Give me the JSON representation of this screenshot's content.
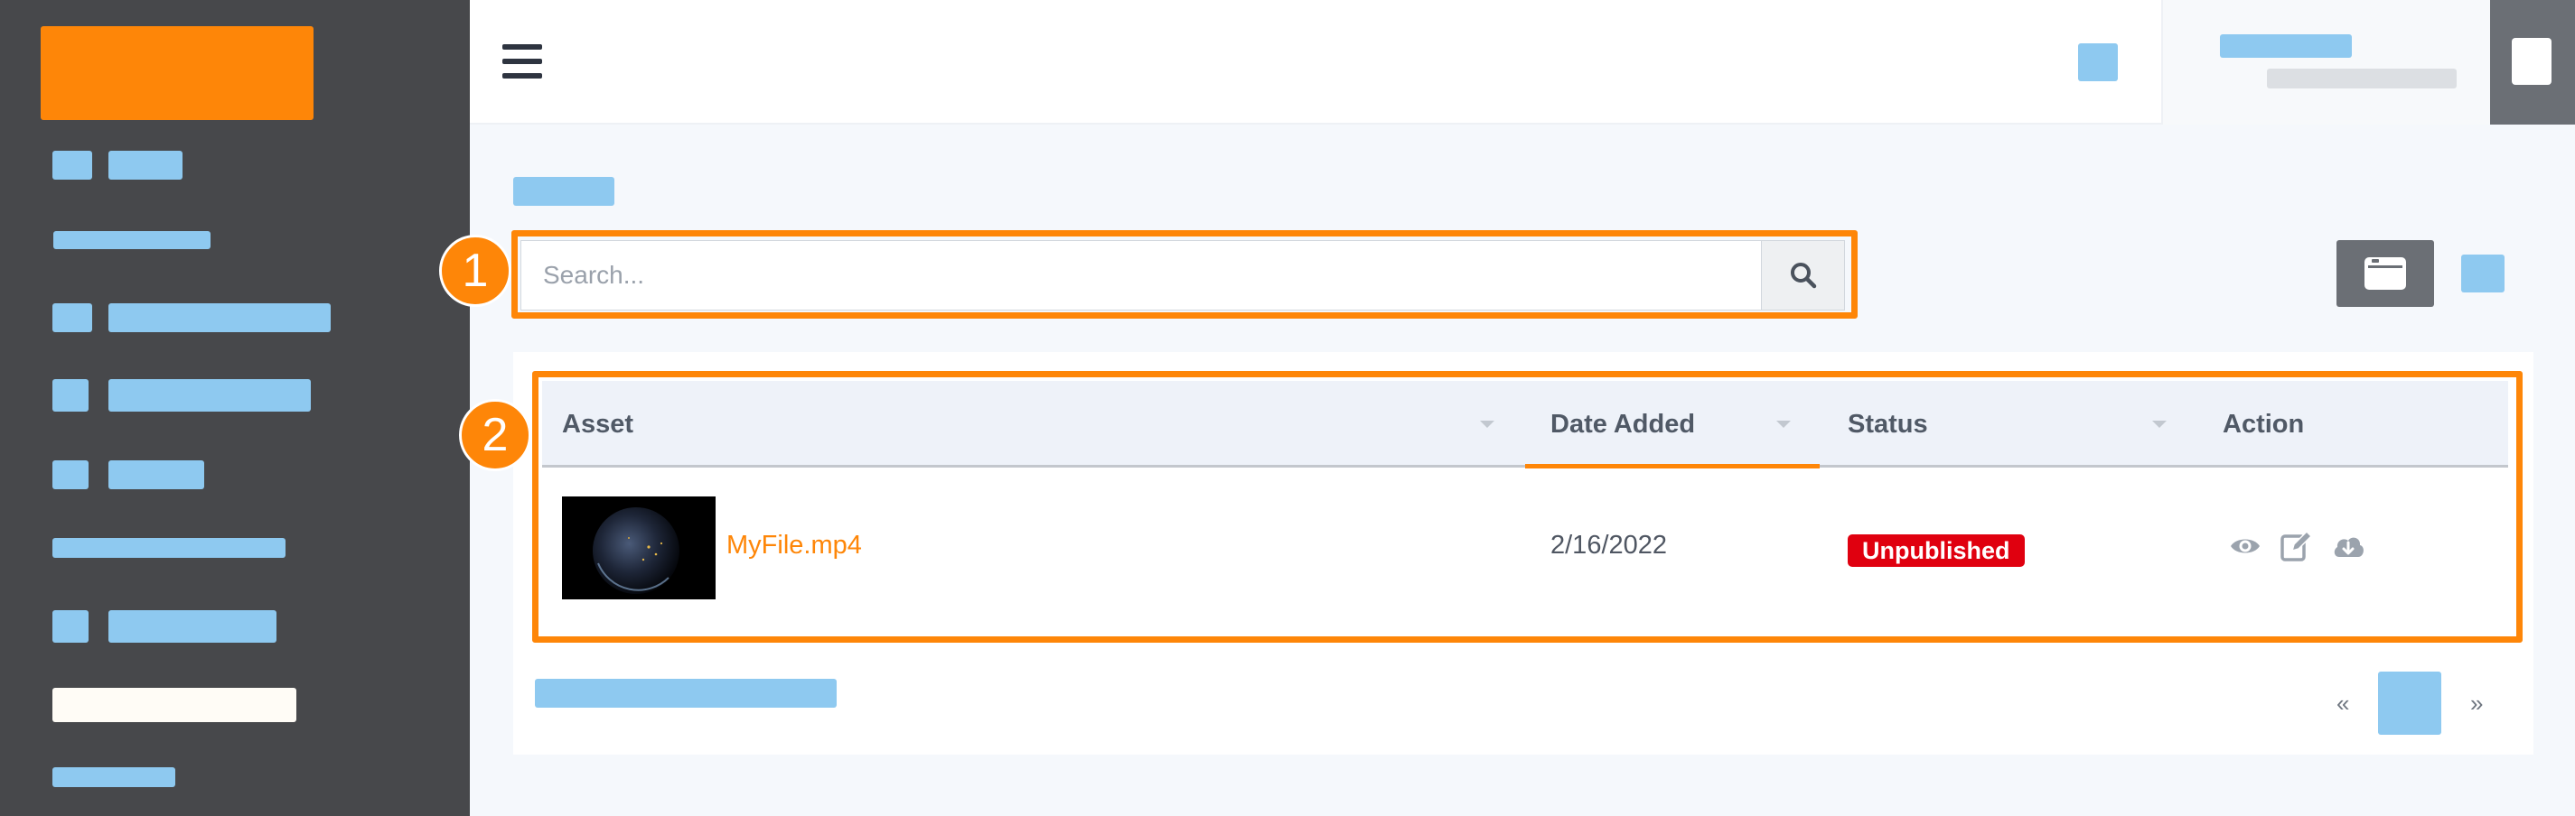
{
  "search": {
    "placeholder": "Search..."
  },
  "callouts": [
    "1",
    "2"
  ],
  "table": {
    "columns": [
      "Asset",
      "Date Added",
      "Status",
      "Action"
    ],
    "rows": [
      {
        "asset": "MyFile.mp4",
        "date_added": "2/16/2022",
        "status": "Unpublished"
      }
    ]
  },
  "pagination": {
    "prev": "«",
    "next": "»"
  },
  "icons": {
    "menu": "hamburger-icon",
    "search": "magnifier-icon",
    "view": "card-view-icon",
    "actions": [
      "eye-icon",
      "edit-icon",
      "cloud-download-icon"
    ]
  },
  "colors": {
    "accent": "#fe8608",
    "sidebar": "#47484b",
    "placeholder_blocks": "#8ec9f0",
    "status_unpublished": "#e0000f"
  }
}
